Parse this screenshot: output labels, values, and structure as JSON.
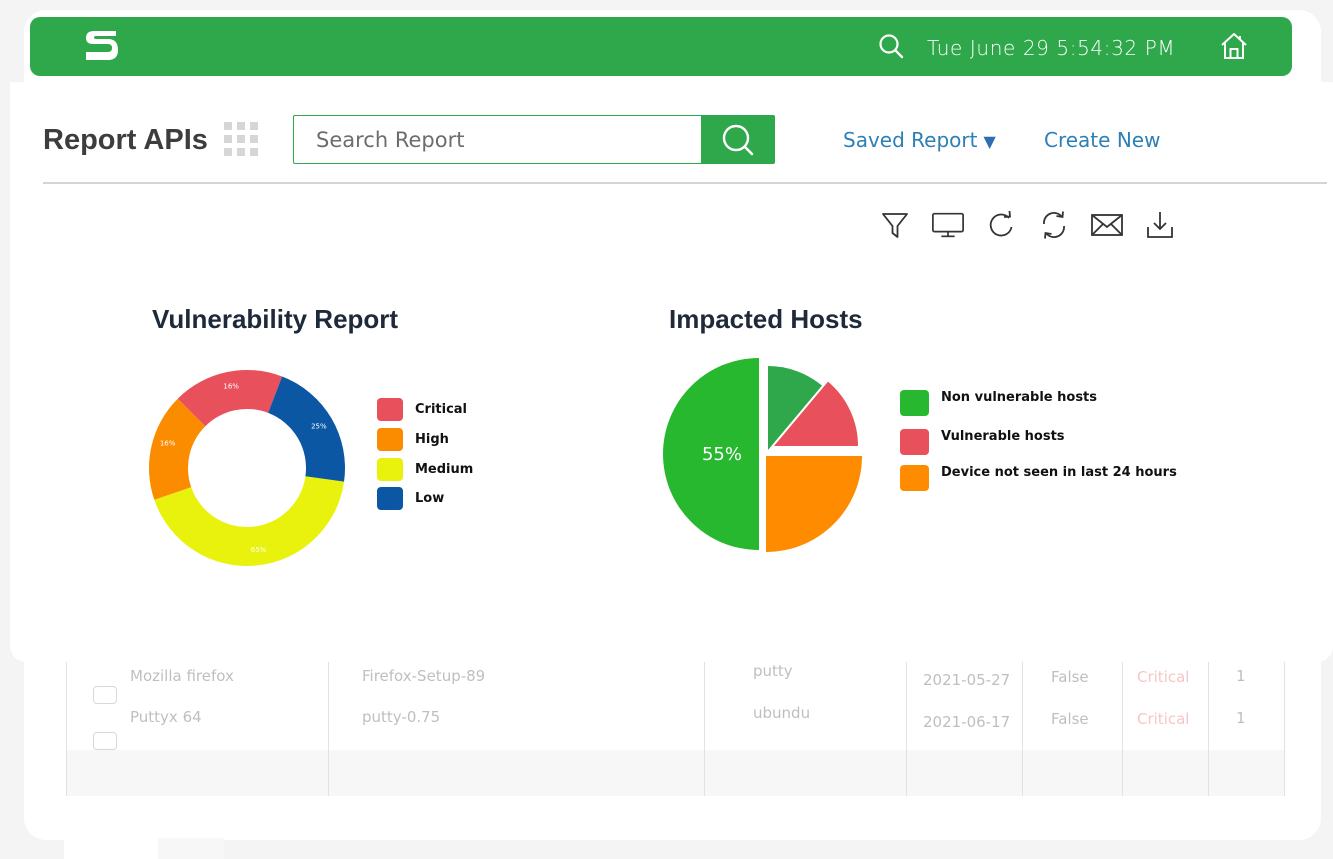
{
  "header": {
    "datetime": "Tue June 29 5:54:32 PM",
    "logo_letter": "S",
    "icons": [
      "logo-s-icon",
      "search-icon",
      "home-icon"
    ]
  },
  "toolbar_top": {
    "title": "Report APIs",
    "search_placeholder": "Search Report",
    "saved_report": "Saved Report",
    "create_new": "Create New"
  },
  "action_icons": [
    "filter-icon",
    "monitor-icon",
    "refresh-icon",
    "sync-icon",
    "mail-icon",
    "download-icon"
  ],
  "colors": {
    "brand_green": "#2ea84a",
    "link_blue": "#2d7fb6",
    "critical": "#e8505b",
    "high": "#fb8c00",
    "medium": "#e8f20c",
    "low": "#0b57a3",
    "non_vulnerable": "#28b82f",
    "vulnerable": "#e8505b",
    "not_seen": "#ff8c00"
  },
  "chart_data": [
    {
      "type": "pie",
      "title": "Vulnerability Report",
      "donut": true,
      "categories": [
        "Critical",
        "High",
        "Medium",
        "Low"
      ],
      "values": [
        16,
        16,
        65,
        25
      ],
      "labels": [
        "16%",
        "16%",
        "65%",
        "25%"
      ],
      "legend_position": "right"
    },
    {
      "type": "pie",
      "title": "Impacted Hosts",
      "categories": [
        "Non vulnerable hosts",
        "Vulnerable hosts",
        "Device not seen in last 24 hours"
      ],
      "values": [
        55,
        20,
        25
      ],
      "labels": [
        "55%"
      ],
      "legend_position": "right"
    }
  ],
  "table": {
    "rows": [
      {
        "name": "Mozilla firefox",
        "file": "Firefox-Setup-89",
        "host": "putty",
        "date": "2021-05-27",
        "flag": "False",
        "severity": "Critical",
        "count": "1"
      },
      {
        "name": "Puttyx 64",
        "file": "putty-0.75",
        "host": "ubundu",
        "date": "2021-06-17",
        "flag": "False",
        "severity": "Critical",
        "count": "1"
      }
    ]
  }
}
